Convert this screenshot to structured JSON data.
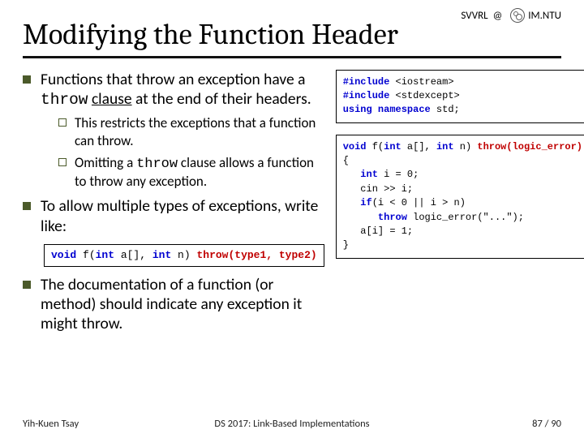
{
  "header": {
    "left": "SVVRL",
    "at": "@",
    "right": "IM.NTU"
  },
  "title": "Modifying the Function Header",
  "bullets": {
    "b1": {
      "pre": "Functions that throw an exception have a ",
      "throw": "throw",
      "mid": " ",
      "clause": "clause",
      "post": " at the end of their headers."
    },
    "s1": "This restricts the exceptions that a function can throw.",
    "s2": {
      "pre": "Omitting a ",
      "throw": "throw",
      "post": " clause allows a function to throw any exception."
    },
    "b2": "To allow multiple types of exceptions, write like:",
    "b3": "The documentation of a function (or method) should indicate any exception it might throw."
  },
  "code_right": {
    "l1a": "#include ",
    "l1b": "<iostream>",
    "l2a": "#include ",
    "l2b": "<stdexcept>",
    "l3a": "using namespace ",
    "l3b": "std;",
    "blank": " ",
    "l4a": "void",
    "l4b": " f(",
    "l4c": "int",
    "l4d": " a[], ",
    "l4e": "int",
    "l4f": " n) ",
    "l4g": "throw(logic_error)",
    "l5": "{",
    "l6a": "   int",
    "l6b": " i = 0;",
    "l7": "   cin >> i;",
    "l8a": "   if",
    "l8b": "(i < 0 || i > n)",
    "l9a": "      throw",
    "l9b": " logic_error(\"...\");",
    "l10": "   a[i] = 1;",
    "l11": "}"
  },
  "code_inline": {
    "a": "void",
    "b": " f(",
    "c": "int",
    "d": " a[], ",
    "e": "int",
    "f": " n) ",
    "g": "throw(type1, type2)"
  },
  "footer": {
    "left": "Yih-Kuen Tsay",
    "center": "DS 2017: Link-Based Implementations",
    "page_cur": "87",
    "page_sep": " / ",
    "page_total": "90"
  }
}
